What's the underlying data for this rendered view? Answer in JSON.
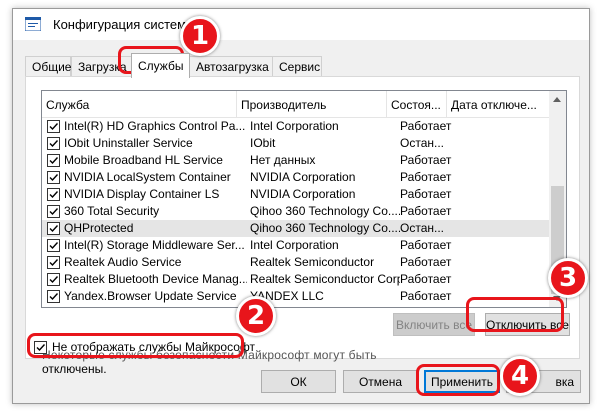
{
  "window": {
    "title": "Конфигурация системы"
  },
  "tabs": [
    {
      "label": "Общие"
    },
    {
      "label": "Загрузка"
    },
    {
      "label": "Службы"
    },
    {
      "label": "Автозагрузка"
    },
    {
      "label": "Сервис"
    }
  ],
  "list": {
    "headers": {
      "service": "Служба",
      "vendor": "Производитель",
      "status": "Состоя...",
      "disabled_date": "Дата отключе..."
    },
    "rows": [
      {
        "name": "Intel(R) HD Graphics Control Pa...",
        "vendor": "Intel Corporation",
        "status": "Работает",
        "checked": true
      },
      {
        "name": "IObit Uninstaller Service",
        "vendor": "IObit",
        "status": "Остан...",
        "checked": true
      },
      {
        "name": "Mobile Broadband HL Service",
        "vendor": "Нет данных",
        "status": "Работает",
        "checked": true
      },
      {
        "name": "NVIDIA LocalSystem Container",
        "vendor": "NVIDIA Corporation",
        "status": "Работает",
        "checked": true
      },
      {
        "name": "NVIDIA Display Container LS",
        "vendor": "NVIDIA Corporation",
        "status": "Работает",
        "checked": true
      },
      {
        "name": "360 Total Security",
        "vendor": "Qihoo 360 Technology Co....",
        "status": "Работает",
        "checked": true
      },
      {
        "name": "QHProtected",
        "vendor": "Qihoo 360 Technology Co....",
        "status": "Остан...",
        "checked": true,
        "selected": true
      },
      {
        "name": "Intel(R) Storage Middleware Ser...",
        "vendor": "Intel Corporation",
        "status": "Работает",
        "checked": true
      },
      {
        "name": "Realtek Audio Service",
        "vendor": "Realtek Semiconductor",
        "status": "Работает",
        "checked": true
      },
      {
        "name": "Realtek Bluetooth Device Manag...",
        "vendor": "Realtek Semiconductor Corp.",
        "status": "Работает",
        "checked": true
      },
      {
        "name": "Yandex.Browser Update Service",
        "vendor": "YANDEX LLC",
        "status": "Работает",
        "checked": true
      }
    ]
  },
  "note": {
    "line1": "Некоторые службы безопасности Майкрософт могут быть",
    "line2": "отключены."
  },
  "buttons": {
    "enable_all": "Включить все",
    "disable_all": "Отключить все",
    "ok": "ОК",
    "cancel": "Отмена",
    "apply": "Применить",
    "help": "вка"
  },
  "hide_ms": {
    "label": "Не отображать службы Майкрософт",
    "checked": true
  },
  "badges": [
    "1",
    "2",
    "3",
    "4"
  ],
  "colors": {
    "highlight": "#e8151b",
    "focus": "#0078d7"
  }
}
